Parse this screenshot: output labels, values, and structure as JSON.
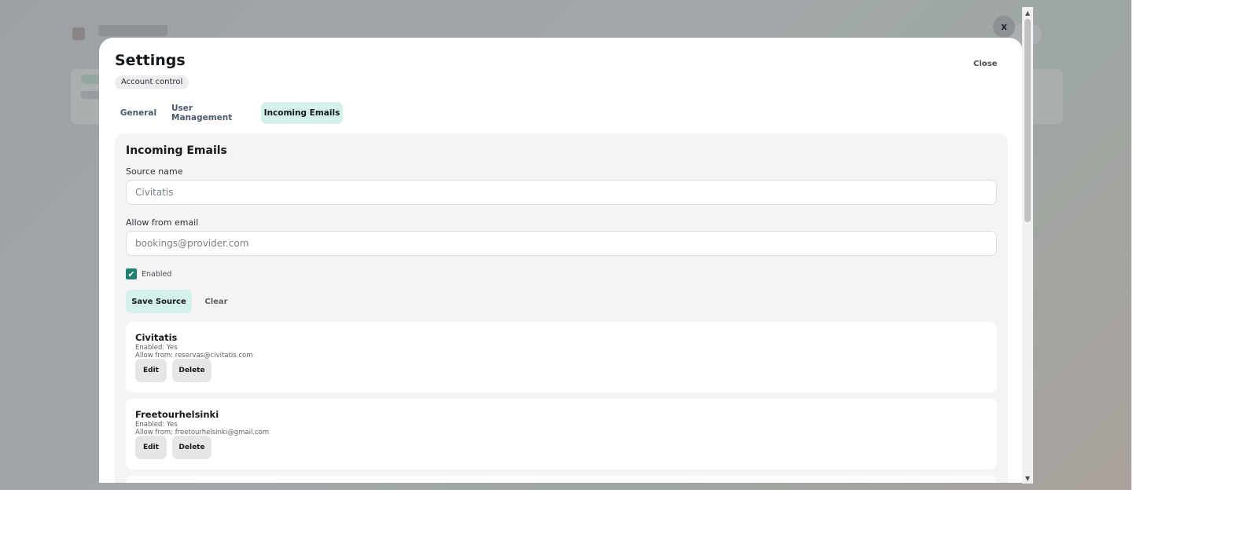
{
  "modal": {
    "title": "Settings",
    "badge": "Account control",
    "close_label": "Close",
    "x_label": "x"
  },
  "tabs": [
    {
      "label": "General",
      "active": false
    },
    {
      "label": "User Management",
      "active": false
    },
    {
      "label": "Incoming Emails",
      "active": true
    }
  ],
  "panel": {
    "title": "Incoming Emails",
    "source_name_label": "Source name",
    "source_name_placeholder": "Civitatis",
    "allow_email_label": "Allow from email",
    "allow_email_placeholder": "bookings@provider.com",
    "enabled_label": "Enabled",
    "enabled_checked": true,
    "save_label": "Save Source",
    "clear_label": "Clear"
  },
  "sources": [
    {
      "name": "Civitatis",
      "enabled": "Enabled: Yes",
      "allow_from": "Allow from: reservas@civitatis.com",
      "edit_label": "Edit",
      "delete_label": "Delete"
    },
    {
      "name": "Freetourhelsinki",
      "enabled": "Enabled: Yes",
      "allow_from": "Allow from: freetourhelsinki@gmail.com",
      "edit_label": "Edit",
      "delete_label": "Delete"
    }
  ],
  "colors": {
    "accent_light": "#d4f0ea",
    "checkbox": "#1e7f72"
  }
}
